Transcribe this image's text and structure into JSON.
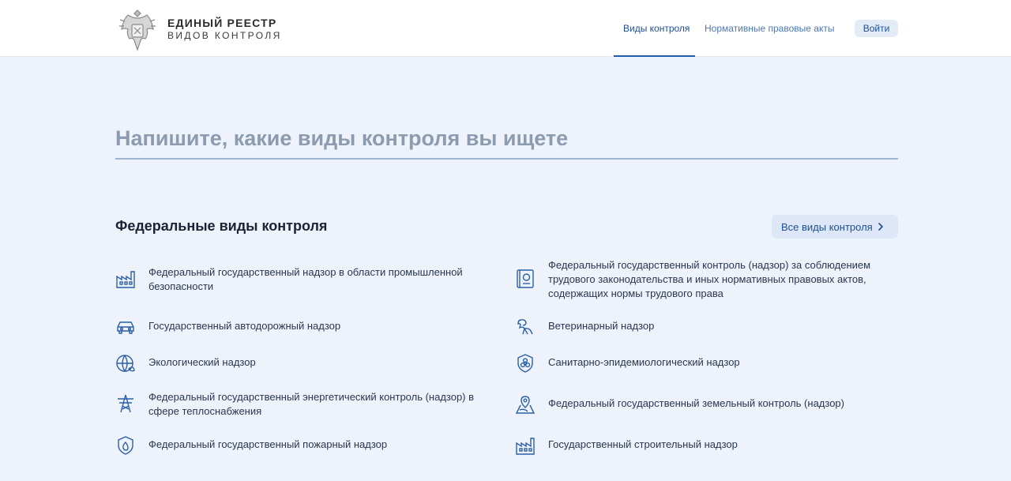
{
  "header": {
    "logo_line1": "ЕДИНЫЙ РЕЕСТР",
    "logo_line2": "ВИДОВ КОНТРОЛЯ",
    "nav": [
      {
        "label": "Виды контроля",
        "active": true
      },
      {
        "label": "Нормативные правовые акты",
        "active": false
      }
    ],
    "login_label": "Войти"
  },
  "search": {
    "placeholder": "Напишите, какие виды контроля вы ищете"
  },
  "section": {
    "title": "Федеральные виды контроля",
    "all_label": "Все виды контроля",
    "items": [
      {
        "icon": "factory-icon",
        "label": "Федеральный государственный надзор в области промышленной безопасности"
      },
      {
        "icon": "labor-code-book-icon",
        "label": "Федеральный государственный контроль (надзор) за соблюдением трудового законодательства и иных нормативных правовых актов, содержащих нормы трудового права"
      },
      {
        "icon": "car-icon",
        "label": "Государственный автодорожный надзор"
      },
      {
        "icon": "dog-icon",
        "label": "Ветеринарный надзор"
      },
      {
        "icon": "globe-leaf-icon",
        "label": "Экологический надзор"
      },
      {
        "icon": "biohazard-shield-icon",
        "label": "Санитарно-эпидемиологический надзор"
      },
      {
        "icon": "power-tower-icon",
        "label": "Федеральный государственный энергетический контроль (надзор) в сфере теплоснабжения"
      },
      {
        "icon": "map-pin-icon",
        "label": "Федеральный государственный земельный контроль (надзор)"
      },
      {
        "icon": "fire-shield-icon",
        "label": "Федеральный государственный пожарный надзор"
      },
      {
        "icon": "building-icon",
        "label": "Государственный строительный надзор"
      }
    ]
  },
  "colors": {
    "accent": "#1e4f95",
    "background": "#eef3fb",
    "icon": "#2b5fa8"
  }
}
